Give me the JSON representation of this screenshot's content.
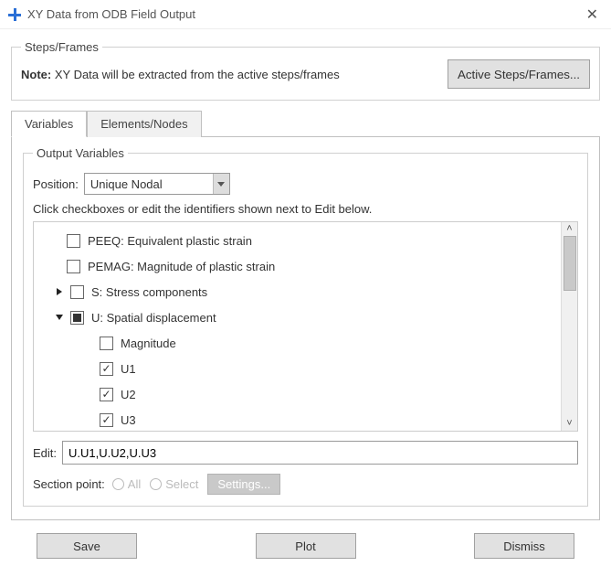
{
  "window": {
    "title": "XY Data from ODB Field Output"
  },
  "steps": {
    "legend": "Steps/Frames",
    "note_label": "Note:",
    "note_text": "XY Data will be extracted from the active steps/frames",
    "active_button": "Active Steps/Frames..."
  },
  "tabs": {
    "variables": "Variables",
    "elements": "Elements/Nodes"
  },
  "outvars": {
    "legend": "Output Variables",
    "position_label": "Position:",
    "position_value": "Unique Nodal",
    "hint": "Click checkboxes or edit the identifiers shown next to Edit below.",
    "tree": {
      "peeq": "PEEQ: Equivalent plastic strain",
      "pemag": "PEMAG: Magnitude of plastic strain",
      "s": "S: Stress components",
      "u": "U: Spatial displacement",
      "magnitude": "Magnitude",
      "u1": "U1",
      "u2": "U2",
      "u3": "U3"
    },
    "edit_label": "Edit:",
    "edit_value": "U.U1,U.U2,U.U3",
    "section_label": "Section point:",
    "radio_all": "All",
    "radio_select": "Select",
    "settings_btn": "Settings..."
  },
  "footer": {
    "save": "Save",
    "plot": "Plot",
    "dismiss": "Dismiss"
  }
}
